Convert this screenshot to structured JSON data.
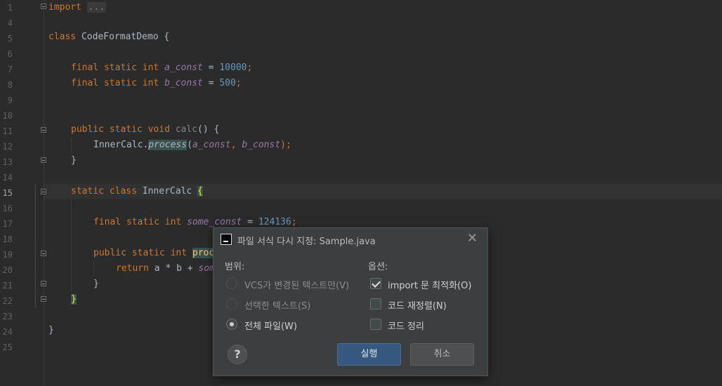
{
  "editor": {
    "line_numbers": [
      "1",
      "4",
      "5",
      "6",
      "7",
      "8",
      "9",
      "10",
      "11",
      "12",
      "13",
      "14",
      "15",
      "16",
      "17",
      "18",
      "19",
      "20",
      "21",
      "22",
      "23",
      "24",
      "25"
    ],
    "current_line": "15",
    "code": {
      "l1_import": "import",
      "l1_fold": "...",
      "l5_class_kw": "class",
      "l5_name": "CodeFormatDemo",
      "l5_brace": "{",
      "l7_final": "final",
      "l7_static": "static",
      "l7_int": "int",
      "l7_field": "a_const",
      "l7_eq": "=",
      "l7_num": "10000",
      "l7_semi": ";",
      "l8_final": "final",
      "l8_static": "static",
      "l8_int": "int",
      "l8_field": "b_const",
      "l8_eq": "=",
      "l8_num": "500",
      "l8_semi": ";",
      "l11_public": "public",
      "l11_static": "static",
      "l11_void": "void",
      "l11_name": "calc",
      "l11_rest": "() {",
      "l12_cls": "InnerCalc.",
      "l12_meth": "process",
      "l12_open": "(",
      "l12_a": "a_const",
      "l12_comma": ", ",
      "l12_b": "b_const",
      "l12_close": ");",
      "l13_brace": "}",
      "l15_static": "static",
      "l15_class": "class",
      "l15_name": "InnerCalc",
      "l15_brace": "{",
      "l17_final": "final",
      "l17_static": "static",
      "l17_int": "int",
      "l17_field": "some_const",
      "l17_eq": "=",
      "l17_num": "124136",
      "l17_semi": ";",
      "l19_public": "public",
      "l19_static": "static",
      "l19_int": "int",
      "l19_name": "proc",
      "l20_return": "return",
      "l20_expr": "a * b +",
      "l20_field": "som",
      "l21_brace": "}",
      "l22_brace": "}",
      "l24_brace": "}"
    }
  },
  "dialog": {
    "title": "파일 서식 다시 지정: Sample.java",
    "close_glyph": "✕",
    "scope_label": "범위:",
    "options_label": "옵션:",
    "scope": [
      {
        "label": "VCS가 변경된 텍스트만(V)",
        "selected": false,
        "enabled": false
      },
      {
        "label": "선택한 텍스트(S)",
        "selected": false,
        "enabled": false
      },
      {
        "label": "전체 파일(W)",
        "selected": true,
        "enabled": true
      }
    ],
    "options": [
      {
        "label": "import 문 최적화(O)",
        "checked": true
      },
      {
        "label": "코드 재정렬(N)",
        "checked": false
      },
      {
        "label": "코드 정리",
        "checked": false
      }
    ],
    "help_glyph": "?",
    "run_label": "실행",
    "cancel_label": "취소"
  }
}
